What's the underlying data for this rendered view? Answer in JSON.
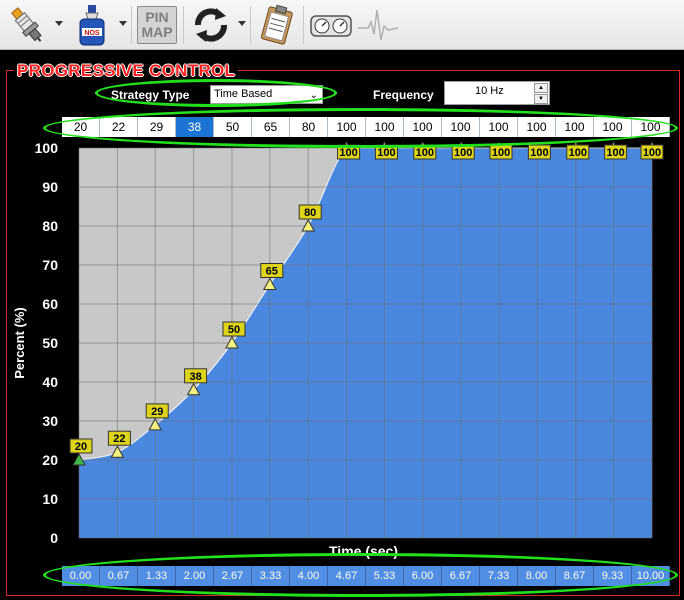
{
  "toolbar": {
    "icons": [
      "spark-plug-icon",
      "nos-bottle-icon",
      "pin-map-icon",
      "refresh-icon",
      "clipboard-icon",
      "gauges-icon",
      "waveform-icon"
    ],
    "pin_map_line1": "PIN",
    "pin_map_line2": "MAP"
  },
  "panel": {
    "title": "PROGRESSIVE CONTROL",
    "strategy_label": "Strategy Type",
    "strategy_value": "Time Based",
    "frequency_label": "Frequency",
    "frequency_value": "10 Hz",
    "percent_values": [
      "20",
      "22",
      "29",
      "38",
      "50",
      "65",
      "80",
      "100",
      "100",
      "100",
      "100",
      "100",
      "100",
      "100",
      "100",
      "100"
    ],
    "selected_index": 3,
    "time_values": [
      "0.00",
      "0.67",
      "1.33",
      "2.00",
      "2.67",
      "3.33",
      "4.00",
      "4.67",
      "5.33",
      "6.00",
      "6.67",
      "7.33",
      "8.00",
      "8.67",
      "9.33",
      "10.00"
    ]
  },
  "colors": {
    "panel_title": "#ff2020",
    "fill": "#4a88e0",
    "plot_bg": "#c8c8c8",
    "highlight_ring": "#22e01c",
    "label_box": "#ddd41a",
    "selected_cell": "#1b73d3"
  },
  "chart_data": {
    "type": "area",
    "xlabel": "Time (sec)",
    "ylabel": "Percent (%)",
    "x": [
      0.0,
      0.67,
      1.33,
      2.0,
      2.67,
      3.33,
      4.0,
      4.67,
      5.33,
      6.0,
      6.67,
      7.33,
      8.0,
      8.67,
      9.33,
      10.0
    ],
    "y": [
      20,
      22,
      29,
      38,
      50,
      65,
      80,
      100,
      100,
      100,
      100,
      100,
      100,
      100,
      100,
      100
    ],
    "xlim": [
      0,
      10
    ],
    "ylim": [
      0,
      100
    ],
    "yticks": [
      0,
      10,
      20,
      30,
      40,
      50,
      60,
      70,
      80,
      90,
      100
    ],
    "grid": true
  }
}
